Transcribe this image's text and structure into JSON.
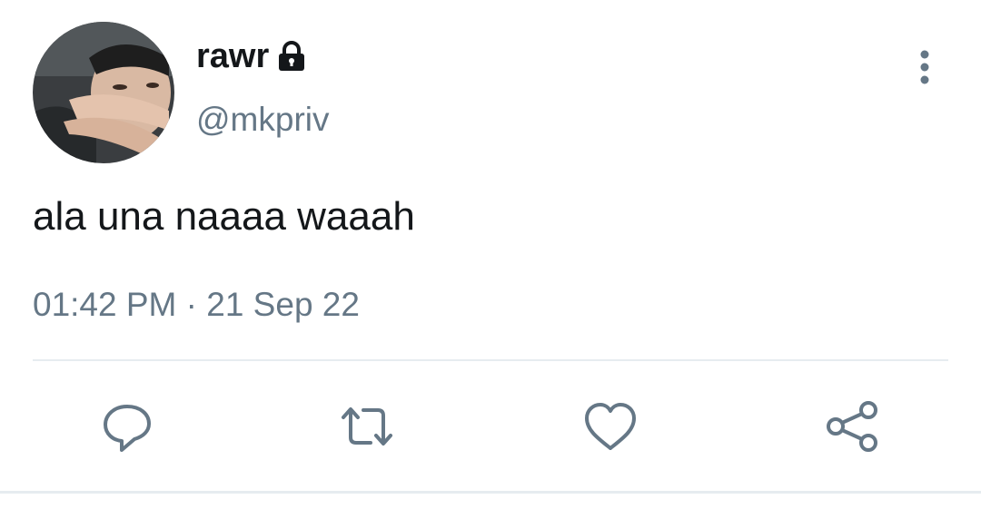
{
  "user": {
    "display_name": "rawr",
    "handle": "@mkpriv",
    "protected_icon": "lock-icon",
    "avatar_icon": "user-avatar-photo"
  },
  "tweet": {
    "text": "ala una naaaa waaah",
    "timestamp": "01:42 PM · 21 Sep 22"
  },
  "menu_icon": "more-vertical-icon",
  "actions": [
    {
      "name": "reply",
      "icon": "speech-bubble-icon"
    },
    {
      "name": "retweet",
      "icon": "retweet-arrows-icon"
    },
    {
      "name": "like",
      "icon": "heart-icon"
    },
    {
      "name": "share",
      "icon": "share-nodes-icon"
    }
  ],
  "colors": {
    "primary_text": "#14171a",
    "secondary_text": "#657786",
    "divider": "#e6ecf0",
    "icon": "#657786"
  }
}
